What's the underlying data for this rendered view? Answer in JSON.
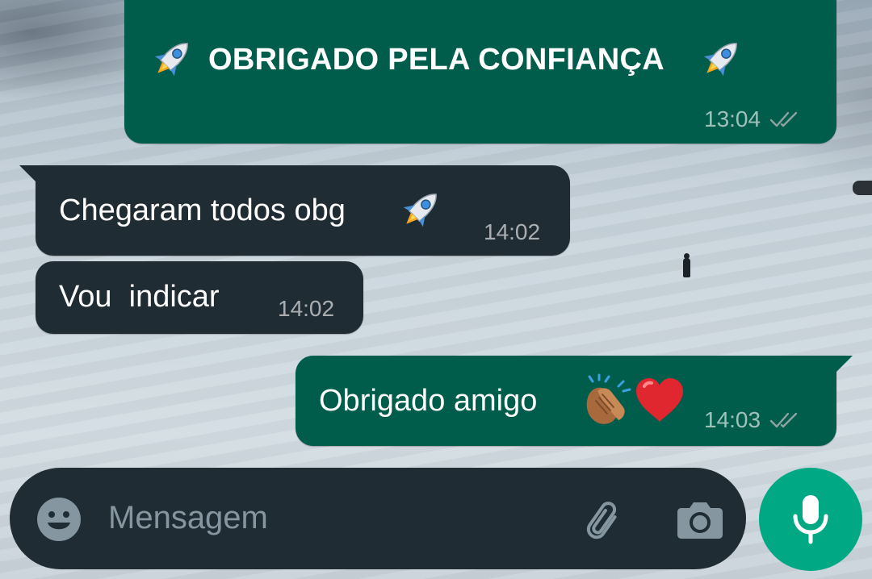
{
  "messages": [
    {
      "direction": "outgoing",
      "text": "OBRIGADO PELA CONFIANÇA",
      "time": "13:04",
      "status": "read",
      "emojis": [
        "rocket",
        "rocket"
      ]
    },
    {
      "direction": "incoming",
      "text": "Chegaram todos obg",
      "time": "14:02",
      "emojis": [
        "rocket"
      ]
    },
    {
      "direction": "incoming",
      "text": "Vou  indicar",
      "time": "14:02"
    },
    {
      "direction": "outgoing",
      "text": "Obrigado amigo",
      "time": "14:03",
      "status": "read",
      "emojis": [
        "clapping-hands",
        "red-heart"
      ]
    }
  ],
  "composer": {
    "placeholder": "Mensagem",
    "icons": [
      "emoji-icon",
      "attach-icon",
      "camera-icon",
      "mic-icon"
    ]
  },
  "colors": {
    "outgoing_bubble": "#005c4b",
    "incoming_bubble": "#202c33",
    "composer_bg": "#202c33",
    "accent": "#00a884",
    "meta_text": "#8fa3a0"
  }
}
